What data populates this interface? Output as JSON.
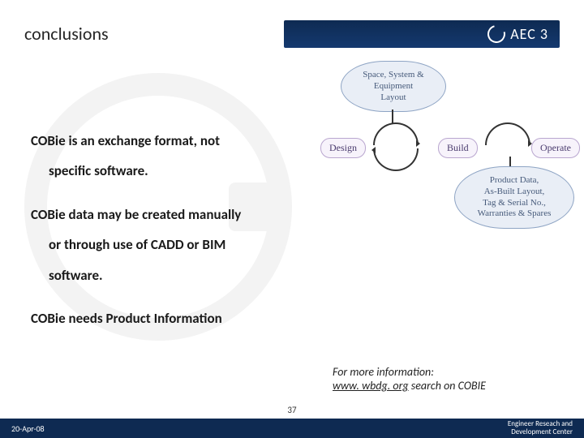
{
  "header": {
    "title": "conclusions",
    "brand": "AEC 3"
  },
  "bullets": {
    "b1_line1": "COBie is an exchange format, not",
    "b1_line2": "specific software.",
    "b2_line1": "COBie data may be created manually",
    "b2_line2": "or through use of CADD or BIM",
    "b2_line3": "software.",
    "b3_line1": "COBie needs Product Information"
  },
  "diagram": {
    "cloud_top_l1": "Space, System &",
    "cloud_top_l2": "Equipment",
    "cloud_top_l3": "Layout",
    "design": "Design",
    "build": "Build",
    "operate": "Operate",
    "cloud_bottom_l1": "Product Data,",
    "cloud_bottom_l2": "As-Built Layout,",
    "cloud_bottom_l3": "Tag & Serial No.,",
    "cloud_bottom_l4": "Warranties & Spares"
  },
  "moreinfo": {
    "lead": "For more information:",
    "link": "www. wbdg. org",
    "tail": " search on COBIE"
  },
  "footer": {
    "date": "20-Apr-08",
    "page": "37",
    "affil_l1": "Engineer Reseach and",
    "affil_l2": "Development Center"
  }
}
